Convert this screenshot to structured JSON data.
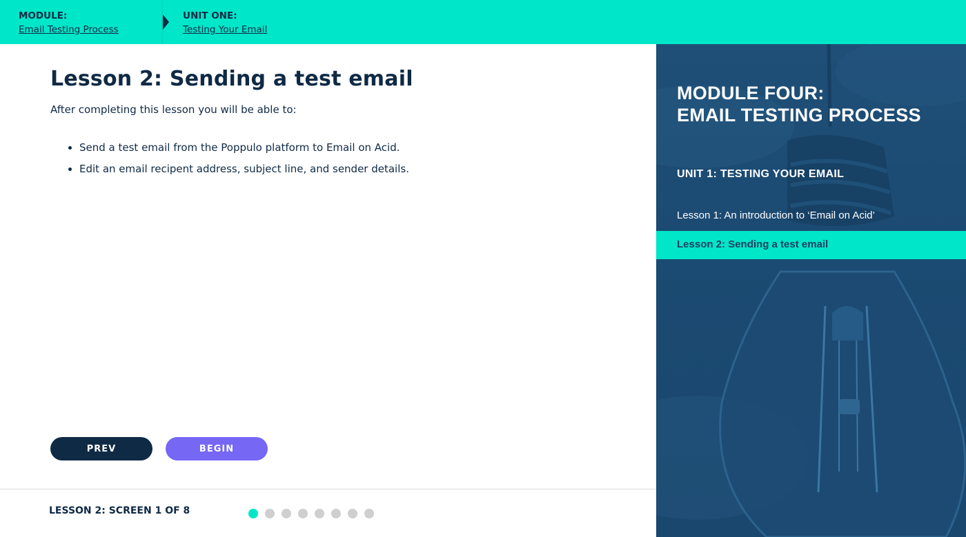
{
  "breadcrumb": {
    "module_kicker": "MODULE:",
    "module_link": "Email Testing Process",
    "unit_kicker": "UNIT ONE:",
    "unit_link": "Testing Your Email"
  },
  "main": {
    "title": "Lesson 2: Sending a test email",
    "intro": "After completing this lesson you will be able to:",
    "objectives": [
      "Send a test email from the Poppulo platform to Email on Acid.",
      "Edit an email recipent address, subject line, and sender details."
    ],
    "prev_label": "PREV",
    "begin_label": "BEGIN"
  },
  "footer": {
    "screen_label": "LESSON 2: SCREEN 1 OF 8",
    "total_screens": 8,
    "current_screen": 1
  },
  "sidebar": {
    "module_line1": "MODULE FOUR:",
    "module_line2": "EMAIL TESTING PROCESS",
    "unit": "UNIT 1: TESTING YOUR EMAIL",
    "lessons": [
      "Lesson 1: An introduction to ‘Email on Acid’",
      "Lesson 2: Sending a test email"
    ]
  },
  "colors": {
    "accent": "#00e6c9",
    "navy": "#0f2a45",
    "begin_button": "#7667f4",
    "sidebar_bg": "#1b4a72",
    "dot_inactive": "#cfcfcf"
  }
}
